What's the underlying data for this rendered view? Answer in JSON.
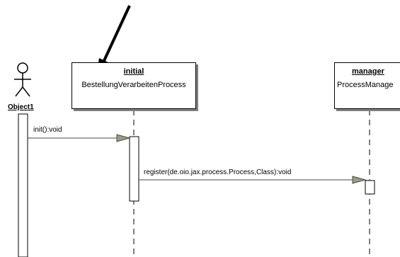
{
  "actor": {
    "label": "Object1"
  },
  "objects": [
    {
      "name": "initial",
      "class": "BestellungVerarbeitenProcess"
    },
    {
      "name": "manager",
      "class": "ProcessManage"
    }
  ],
  "messages": [
    {
      "label": "init():void"
    },
    {
      "label": "register(de.oio.jax.process.Process,Class):void"
    }
  ],
  "colors": {
    "line": "#000000",
    "shadow": "#808080",
    "message_line": "#4a4a3a",
    "arrow_fill": "#9a9a8a"
  }
}
